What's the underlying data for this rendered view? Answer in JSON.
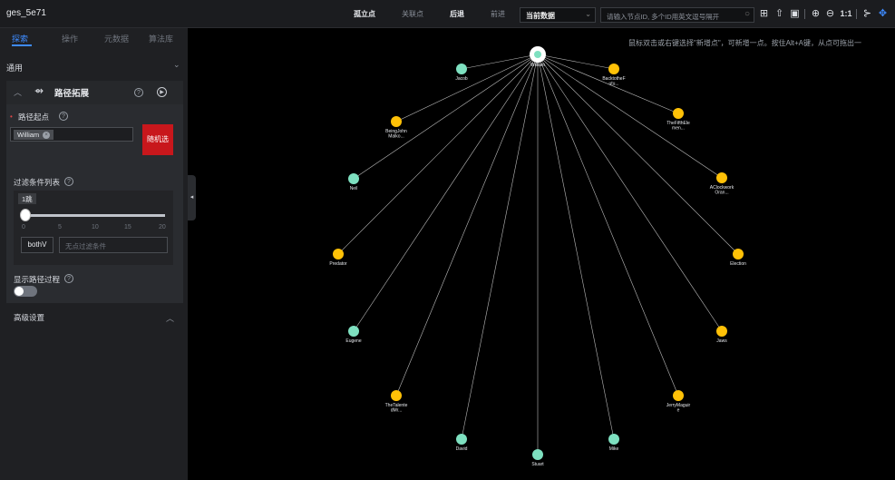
{
  "app": {
    "title": "ges_5e71"
  },
  "toolbar": {
    "isolated": "孤立点",
    "related": "关联点",
    "back": "后退",
    "forward": "前进",
    "dataset": "当前数据",
    "search_placeholder": "请输入节点ID, 多个ID用英文逗号隔开",
    "ratio": "1:1",
    "icons": [
      "search-icon",
      "import-icon",
      "export-icon",
      "screen-icon",
      "zoom-in-icon",
      "zoom-out-icon",
      "layout-icon",
      "focus-icon"
    ]
  },
  "tabs": [
    "探索",
    "操作",
    "元数据",
    "算法库"
  ],
  "panel": {
    "general": "通用",
    "card_title": "路径拓展",
    "start_label": "路径起点",
    "start_value": "William",
    "random_btn": "随机选",
    "filter_label": "过滤条件列表",
    "hop_badge": "1跳",
    "ticks": [
      "0",
      "5",
      "10",
      "15",
      "20"
    ],
    "direction": "bothV",
    "cond_placeholder": "无点过滤条件",
    "show_process": "显示路径过程",
    "advanced": "高级设置"
  },
  "canvas": {
    "hint": "鼠标双击或右键选择\"新增点\"，可新增一点。按住Alt+A键，从点可拖出一",
    "center": {
      "label": "William",
      "color": "#7ee0c0"
    },
    "nodes": [
      {
        "label": [
          "Jacob"
        ],
        "color": "#7ee0c0"
      },
      {
        "label": [
          "BacktotheF",
          "utu..."
        ],
        "color": "#ffc107"
      },
      {
        "label": [
          "BeingJohn",
          "Malko..."
        ],
        "color": "#ffc107"
      },
      {
        "label": [
          "TheFifthEle",
          "men..."
        ],
        "color": "#ffc107"
      },
      {
        "label": [
          "Neil"
        ],
        "color": "#7ee0c0"
      },
      {
        "label": [
          "AClockwork",
          "Oran..."
        ],
        "color": "#ffc107"
      },
      {
        "label": [
          "Predator"
        ],
        "color": "#ffc107"
      },
      {
        "label": [
          "Election"
        ],
        "color": "#ffc107"
      },
      {
        "label": [
          "Eugene"
        ],
        "color": "#7ee0c0"
      },
      {
        "label": [
          "Jaws"
        ],
        "color": "#ffc107"
      },
      {
        "label": [
          "TheTalente",
          "dMr..."
        ],
        "color": "#ffc107"
      },
      {
        "label": [
          "JerryMaguir",
          "e"
        ],
        "color": "#ffc107"
      },
      {
        "label": [
          "David"
        ],
        "color": "#7ee0c0"
      },
      {
        "label": [
          "Mike"
        ],
        "color": "#7ee0c0"
      },
      {
        "label": [
          "Stuart"
        ],
        "color": "#7ee0c0"
      }
    ]
  }
}
